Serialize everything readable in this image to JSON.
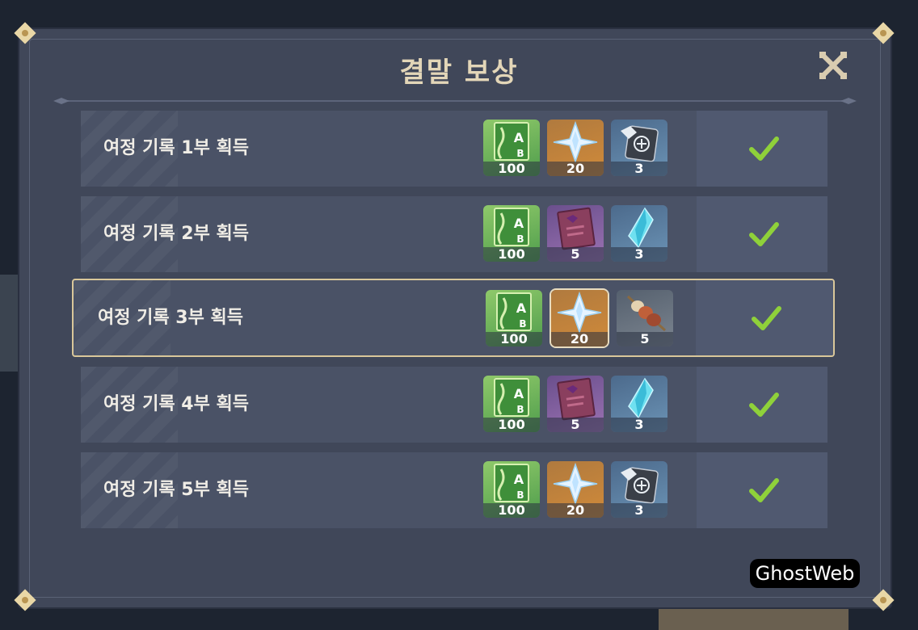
{
  "title": "결말 보상",
  "watermark": "GhostWeb",
  "rows": [
    {
      "label": "여정 기록 1부 획득",
      "rewards": [
        {
          "icon": "experience-book-icon",
          "qty": "100",
          "bg": "green"
        },
        {
          "icon": "primogem-icon",
          "qty": "20",
          "bg": "orange"
        },
        {
          "icon": "weapon-ore-icon",
          "qty": "3",
          "bg": "blue"
        }
      ],
      "completed": true
    },
    {
      "label": "여정 기록 2부 획득",
      "rewards": [
        {
          "icon": "experience-book-icon",
          "qty": "100",
          "bg": "green"
        },
        {
          "icon": "purple-book-icon",
          "qty": "5",
          "bg": "purple"
        },
        {
          "icon": "crystal-shard-icon",
          "qty": "3",
          "bg": "blue"
        }
      ],
      "completed": true
    },
    {
      "label": "여정 기록 3부 획득",
      "rewards": [
        {
          "icon": "experience-book-icon",
          "qty": "100",
          "bg": "green"
        },
        {
          "icon": "primogem-icon",
          "qty": "20",
          "bg": "orange"
        },
        {
          "icon": "meat-skewer-icon",
          "qty": "5",
          "bg": "grey"
        }
      ],
      "completed": true,
      "selected": true
    },
    {
      "label": "여정 기록 4부 획득",
      "rewards": [
        {
          "icon": "experience-book-icon",
          "qty": "100",
          "bg": "green"
        },
        {
          "icon": "purple-book-icon",
          "qty": "5",
          "bg": "purple"
        },
        {
          "icon": "crystal-shard-icon",
          "qty": "3",
          "bg": "blue"
        }
      ],
      "completed": true
    },
    {
      "label": "여정 기록 5부 획득",
      "rewards": [
        {
          "icon": "experience-book-icon",
          "qty": "100",
          "bg": "green"
        },
        {
          "icon": "primogem-icon",
          "qty": "20",
          "bg": "orange"
        },
        {
          "icon": "weapon-ore-icon",
          "qty": "3",
          "bg": "blue"
        }
      ],
      "completed": true
    }
  ],
  "colors": {
    "check": "#8fd13a",
    "selected_border": "#d9c79a",
    "title": "#e3d6b8"
  }
}
